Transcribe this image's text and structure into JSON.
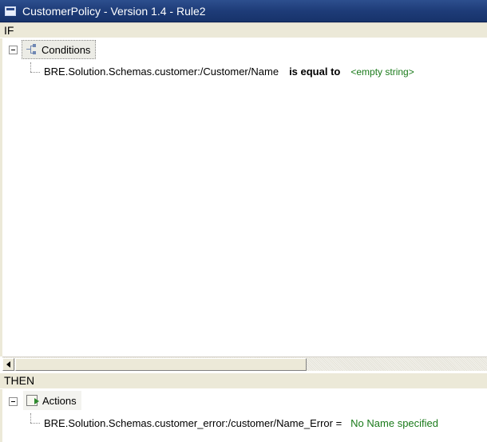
{
  "window": {
    "title": "CustomerPolicy - Version 1.4 - Rule2"
  },
  "if_section": {
    "header": "IF",
    "node_label": "Conditions",
    "conditions": [
      {
        "fact": "BRE.Solution.Schemas.customer:/Customer/Name",
        "operator": "is equal to",
        "value": "<empty string>"
      }
    ]
  },
  "then_section": {
    "header": "THEN",
    "node_label": "Actions",
    "actions": [
      {
        "target": "BRE.Solution.Schemas.customer_error:/customer/Name_Error =",
        "value": "No Name specified"
      }
    ]
  },
  "colors": {
    "title_bar": "#1e3c78",
    "value_text": "#1a7a1a"
  },
  "icons": {
    "window": "window-icon",
    "conditions": "conditions-tree-icon",
    "actions": "actions-icon",
    "collapse": "collapse-minus-icon"
  }
}
